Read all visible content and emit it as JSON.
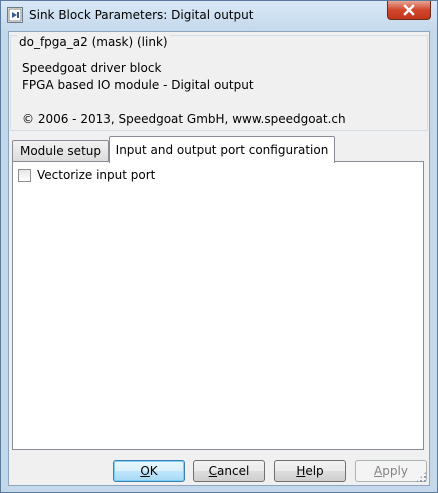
{
  "window": {
    "title": "Sink Block Parameters: Digital output",
    "close_icon": "close-icon"
  },
  "mask": {
    "group_title": "do_fpga_a2 (mask) (link)",
    "description_lines": [
      "Speedgoat driver block",
      "FPGA based IO module - Digital output",
      "",
      "© 2006 - 2013, Speedgoat GmbH, www.speedgoat.ch"
    ]
  },
  "tabs": [
    {
      "label": "Module setup",
      "active": false
    },
    {
      "label": "Input and output port configuration",
      "active": true
    }
  ],
  "panel": {
    "vectorize_label": "Vectorize input port",
    "vectorize_checked": false
  },
  "buttons": {
    "ok_mnemonic": "O",
    "ok_rest": "K",
    "cancel_mnemonic": "C",
    "cancel_rest": "ancel",
    "help_mnemonic": "H",
    "help_rest": "elp",
    "apply_mnemonic": "A",
    "apply_rest": "pply",
    "apply_enabled": false
  },
  "colors": {
    "title_bar": "#c4d8ec",
    "close_button": "#c9442b",
    "default_button_border": "#3c7fb1",
    "client_background": "#f0f0f0"
  }
}
